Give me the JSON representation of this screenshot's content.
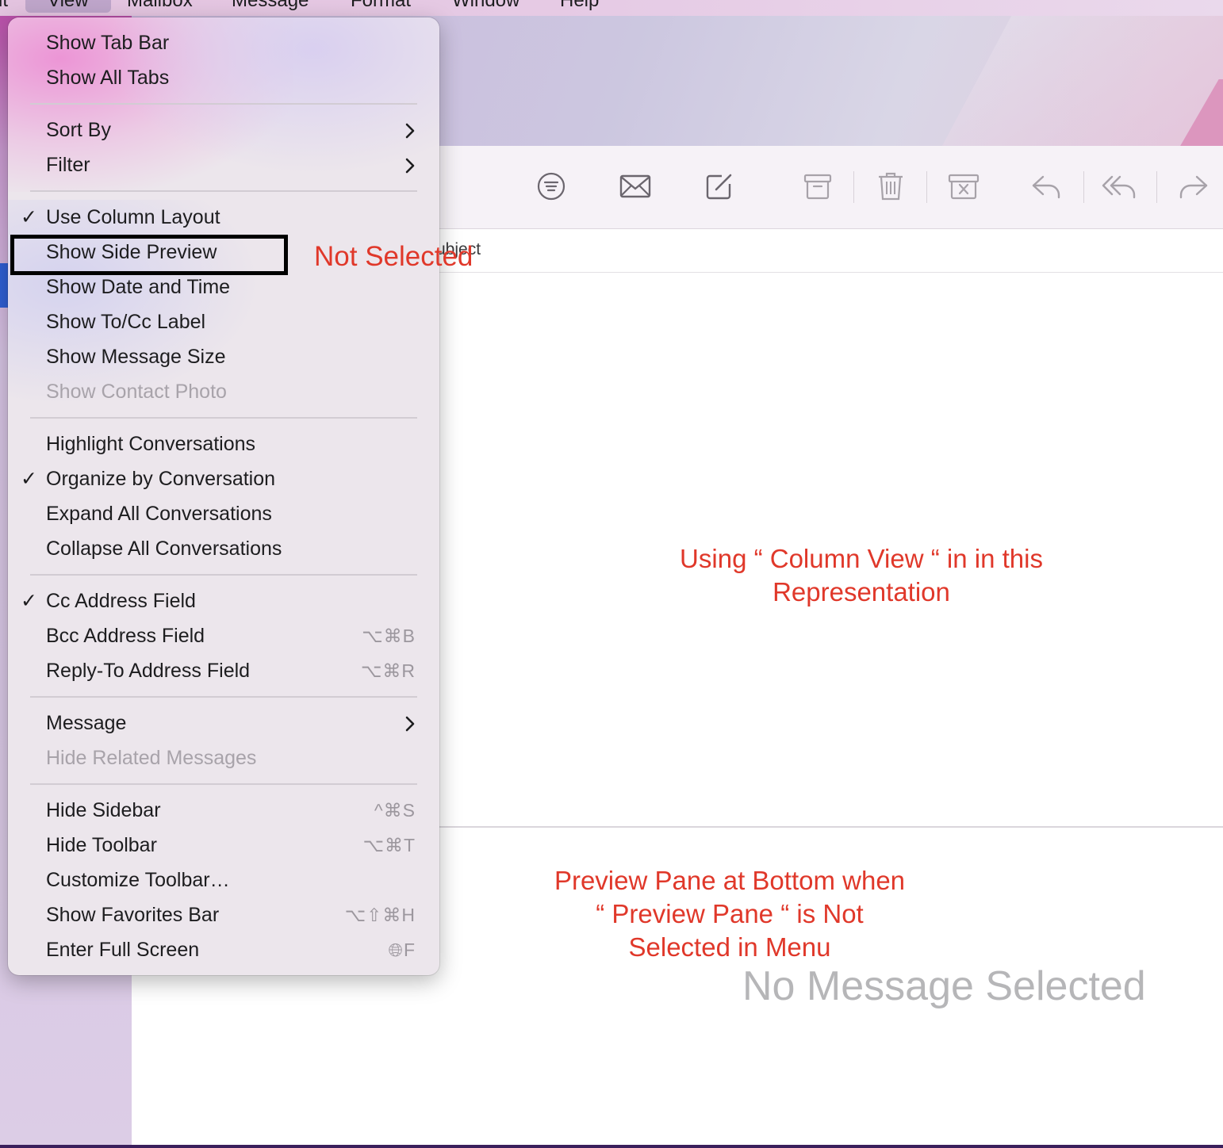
{
  "menubar": {
    "items": [
      "it",
      "View",
      "Mailbox",
      "Message",
      "Format",
      "Window",
      "Help"
    ]
  },
  "toolbar": {
    "icons": [
      "filter-icon",
      "envelope-icon",
      "compose-icon",
      "archive-icon",
      "trash-icon",
      "junk-icon",
      "reply-icon",
      "reply-all-icon",
      "forward-icon"
    ]
  },
  "column_header": {
    "label": "ubject"
  },
  "menu": {
    "items": [
      {
        "label": "Show Tab Bar"
      },
      {
        "label": "Show All Tabs"
      },
      {
        "label": "Sort By",
        "submenu": true
      },
      {
        "label": "Filter",
        "submenu": true
      },
      {
        "label": "Use Column Layout",
        "checked": true
      },
      {
        "label": "Show Side Preview"
      },
      {
        "label": "Show Date and Time"
      },
      {
        "label": "Show To/Cc Label"
      },
      {
        "label": "Show Message Size"
      },
      {
        "label": "Show Contact Photo",
        "disabled": true
      },
      {
        "label": "Highlight Conversations"
      },
      {
        "label": "Organize by Conversation",
        "checked": true
      },
      {
        "label": "Expand All Conversations"
      },
      {
        "label": "Collapse All Conversations"
      },
      {
        "label": "Cc Address Field",
        "checked": true
      },
      {
        "label": "Bcc Address Field",
        "shortcut": "⌥⌘B"
      },
      {
        "label": "Reply-To Address Field",
        "shortcut": "⌥⌘R"
      },
      {
        "label": "Message",
        "submenu": true
      },
      {
        "label": "Hide Related Messages",
        "disabled": true
      },
      {
        "label": "Hide Sidebar",
        "shortcut": "^⌘S"
      },
      {
        "label": "Hide Toolbar",
        "shortcut": "⌥⌘T"
      },
      {
        "label": "Customize Toolbar…"
      },
      {
        "label": "Show Favorites Bar",
        "shortcut": "⌥⇧⌘H"
      },
      {
        "label": "Enter Full Screen",
        "shortcut": "🌐︎F"
      }
    ]
  },
  "annotations": {
    "not_selected": "Not Selected",
    "column_view": [
      "Using “ Column View “ in in this",
      "Representation"
    ],
    "preview_pane": [
      "Preview Pane at Bottom when",
      "“ Preview  Pane “ is Not",
      "Selected in Menu"
    ]
  },
  "preview_pane": {
    "empty_text": "No Message Selected"
  },
  "colors": {
    "annotation": "#e0382a",
    "menu_text": "#1d1d1f",
    "disabled_text": "#a8a3aa",
    "sidebar_selection": "#2f5fd4"
  }
}
